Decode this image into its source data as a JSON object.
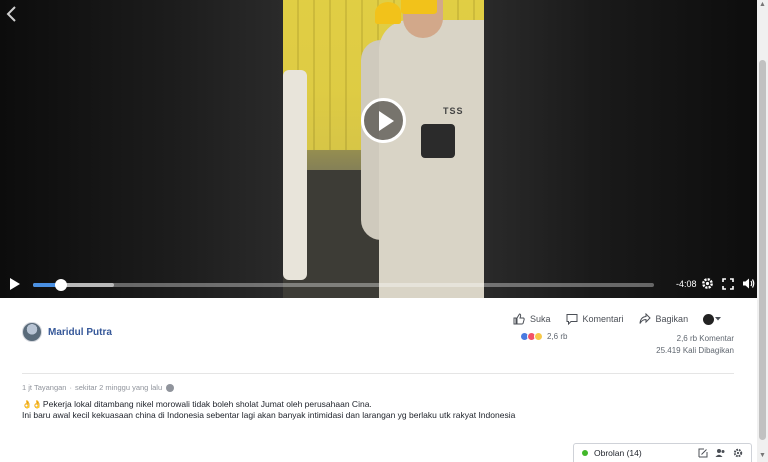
{
  "video": {
    "time_remaining": "-4:08",
    "progress_fraction": 0.045,
    "buffered_fraction": 0.13
  },
  "post": {
    "author": "Maridul Putra",
    "actions": {
      "like": "Suka",
      "comment": "Komentari",
      "share": "Bagikan"
    },
    "reactions_count": "2,6 rb",
    "comments_count": "2,6 rb Komentar",
    "shares_count": "25.419 Kali Dibagikan",
    "views": "1 jt Tayangan",
    "separator": "·",
    "time_ago": "sekitar 2 minggu yang lalu",
    "text_line1": "Pekerja lokal ditambang nikel morowali tidak boleh sholat Jumat oleh perusahaan Cina.",
    "text_line2": "Ini baru awal kecil kekuasaan china di Indonesia sebentar lagi akan banyak intimidasi dan larangan yg berlaku utk rakyat Indonesia",
    "emoji": "👌👌"
  },
  "video_overlay_text": "TSS",
  "chat": {
    "label": "Obrolan (14)"
  },
  "colors": {
    "link_blue": "#365899",
    "progress_blue": "#4a90e2",
    "online_green": "#42b72a"
  }
}
